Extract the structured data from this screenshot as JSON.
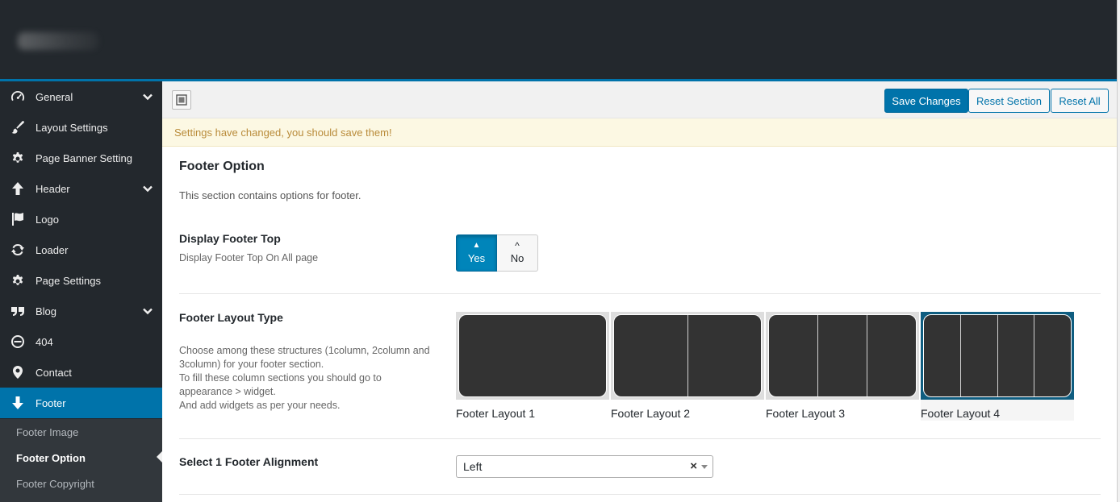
{
  "sidebar": {
    "items": [
      {
        "label": "General",
        "icon": "dashboard-icon",
        "expandable": true
      },
      {
        "label": "Layout Settings",
        "icon": "brush-icon",
        "expandable": false
      },
      {
        "label": "Page Banner Setting",
        "icon": "gear-icon",
        "expandable": false
      },
      {
        "label": "Header",
        "icon": "arrow-up-icon",
        "expandable": true
      },
      {
        "label": "Logo",
        "icon": "flag-icon",
        "expandable": false
      },
      {
        "label": "Loader",
        "icon": "refresh-icon",
        "expandable": false
      },
      {
        "label": "Page Settings",
        "icon": "gear-icon",
        "expandable": false
      },
      {
        "label": "Blog",
        "icon": "quote-icon",
        "expandable": true
      },
      {
        "label": "404",
        "icon": "minus-circle-icon",
        "expandable": false
      },
      {
        "label": "Contact",
        "icon": "location-icon",
        "expandable": false
      },
      {
        "label": "Footer",
        "icon": "arrow-down-icon",
        "expandable": false,
        "active": true
      }
    ],
    "submenu": [
      {
        "label": "Footer Image"
      },
      {
        "label": "Footer Option",
        "current": true
      },
      {
        "label": "Footer Copyright"
      }
    ]
  },
  "toolbar": {
    "save_label": "Save Changes",
    "reset_section_label": "Reset Section",
    "reset_all_label": "Reset All"
  },
  "notice": "Settings have changed, you should save them!",
  "section": {
    "title": "Footer Option",
    "desc": "This section contains options for footer."
  },
  "fields": {
    "footer_top": {
      "title": "Display Footer Top",
      "subtitle": "Display Footer Top On All page",
      "yes_label": "Yes",
      "no_label": "No",
      "value": "Yes"
    },
    "layout_type": {
      "title": "Footer Layout Type",
      "desc_lines": [
        "Choose among these structures (1column, 2column and",
        "3column) for your footer section.",
        "To fill these column sections you should go to",
        "appearance > widget.",
        "And add widgets as per your needs."
      ],
      "options": [
        {
          "label": "Footer Layout 1",
          "columns": 1
        },
        {
          "label": "Footer Layout 2",
          "columns": 2
        },
        {
          "label": "Footer Layout 3",
          "columns": 3
        },
        {
          "label": "Footer Layout 4",
          "columns": 4
        }
      ],
      "selected": "Footer Layout 4"
    },
    "alignment": {
      "title": "Select 1 Footer Alignment",
      "value": "Left",
      "clear_symbol": "×"
    }
  },
  "colors": {
    "accent": "#0073aa",
    "sidebar_bg": "#23282d",
    "notice_bg": "#fcf8e3",
    "notice_text": "#b98b3a"
  }
}
